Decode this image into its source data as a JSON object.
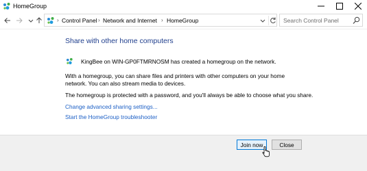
{
  "window": {
    "title": "HomeGroup",
    "app_icon": "homegroup-icon"
  },
  "window_controls": {
    "minimize": "minimize-icon",
    "maximize": "maximize-icon",
    "close": "close-icon"
  },
  "navigation": {
    "back": "back-arrow-icon",
    "forward": "forward-arrow-icon",
    "recent": "chevron-down-icon",
    "up": "up-arrow-icon"
  },
  "address_bar": {
    "breadcrumbs": [
      "Control Panel",
      "Network and Internet",
      "HomeGroup"
    ]
  },
  "search": {
    "placeholder": "Search Control Panel"
  },
  "main": {
    "heading": "Share with other home computers",
    "created_message": "KingBee on WIN-GP0FTMRNOSM has created a homegroup on the network.",
    "description": "With a homegroup, you can share files and printers with other computers on your home network. You can also stream media to devices.",
    "password_note": "The homegroup is protected with a password, and you'll always be able to choose what you share.",
    "links": {
      "advanced_sharing": "Change advanced sharing settings...",
      "troubleshooter": "Start the HomeGroup troubleshooter"
    }
  },
  "footer": {
    "join_label": "Join now",
    "close_label": "Close"
  },
  "colors": {
    "heading": "#1e3d8c",
    "link": "#1a5ec5",
    "footer_bg": "#f0f0f0"
  }
}
